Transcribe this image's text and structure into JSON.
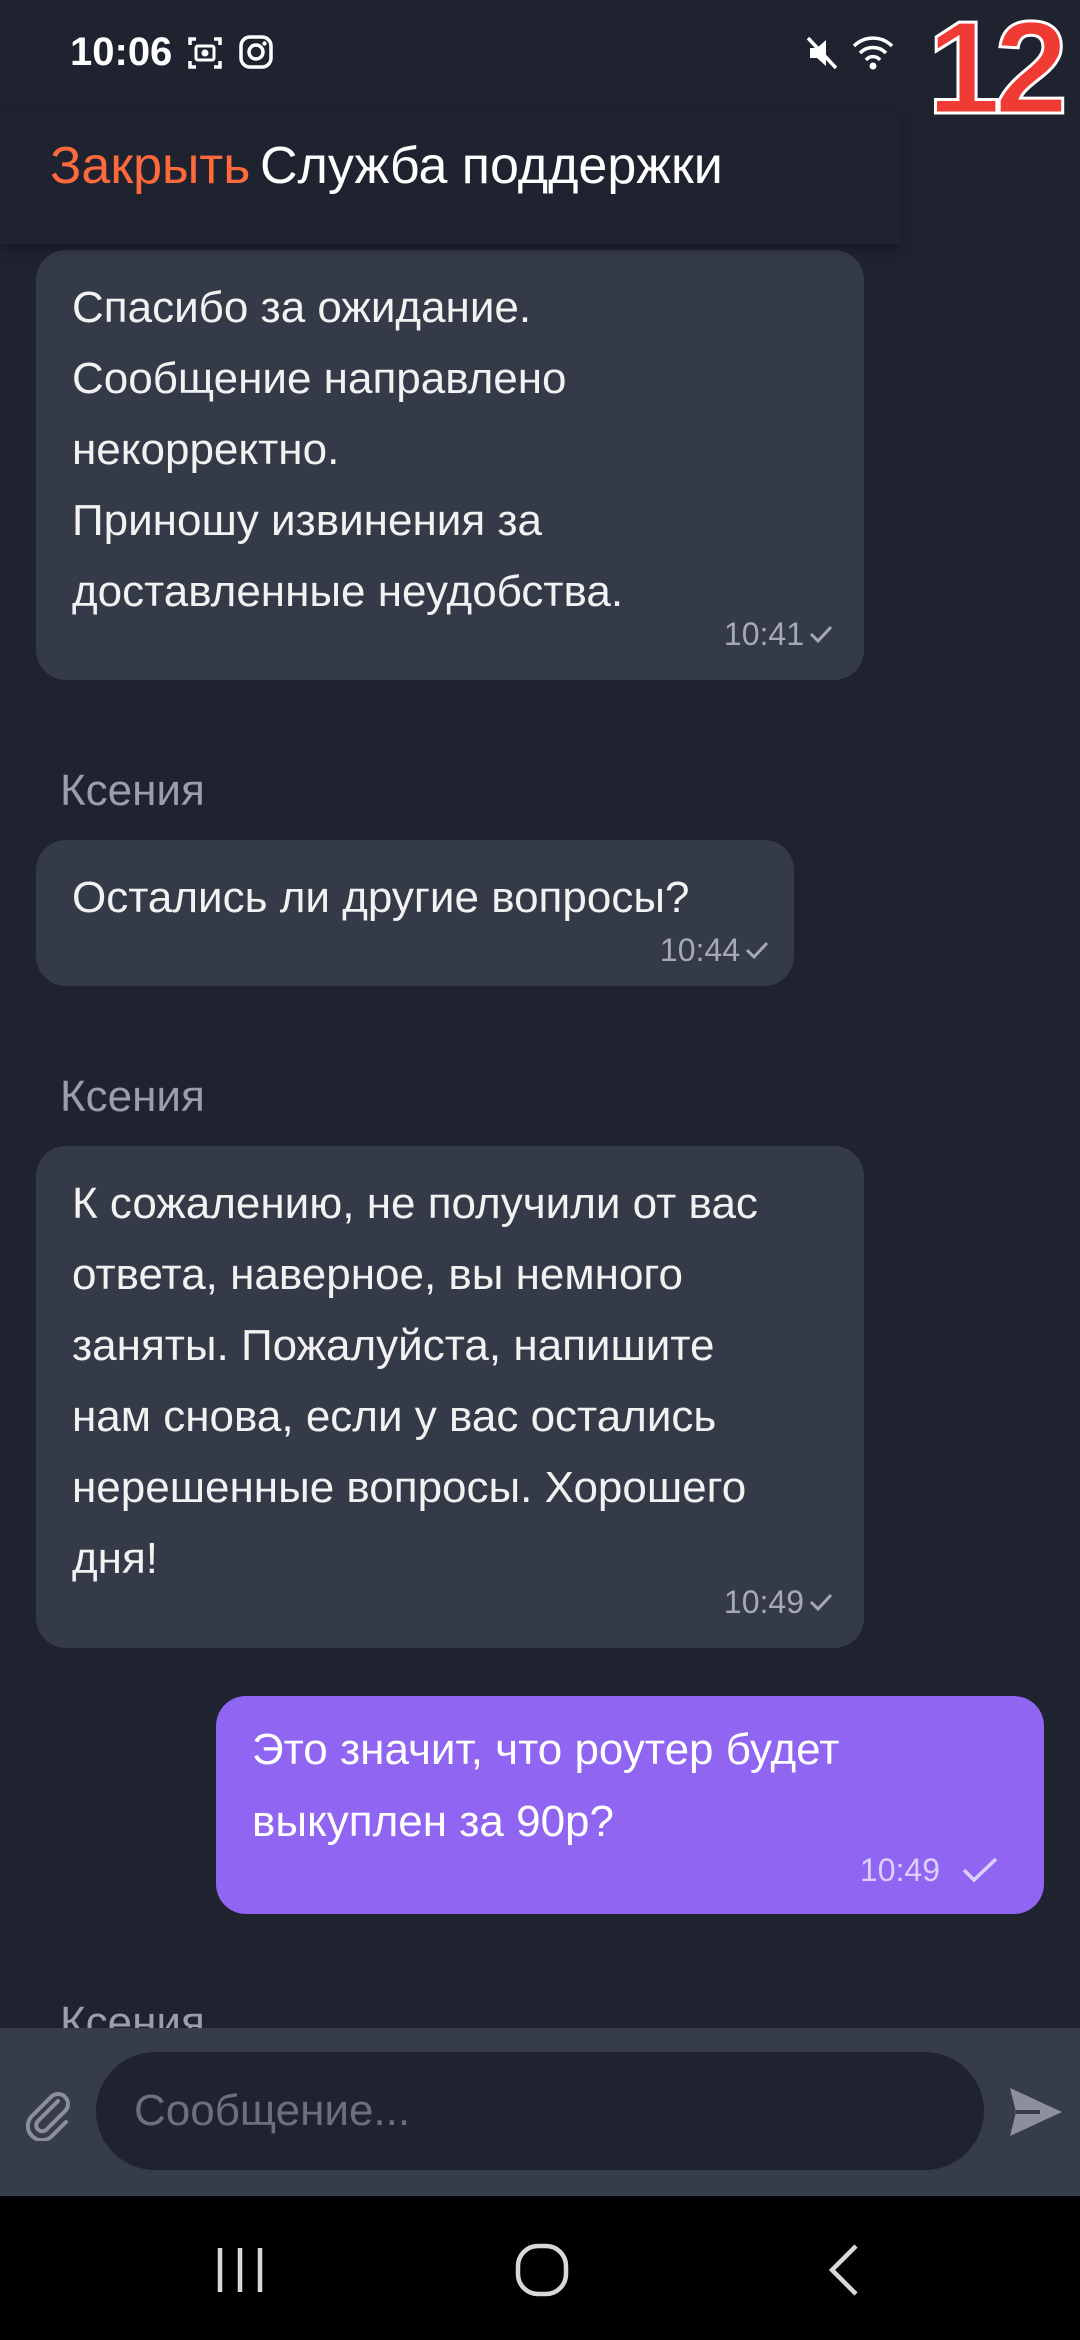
{
  "status_bar": {
    "time": "10:06",
    "overlay_number": "12",
    "icons": [
      "screenshot-icon",
      "instagram-icon",
      "mute-icon",
      "wifi-icon"
    ]
  },
  "header": {
    "close_label": "Закрыть",
    "title": "Служба поддержки"
  },
  "messages": [
    {
      "direction": "incoming",
      "lines": [
        "Спасибо за ожидание.",
        "Сообщение направлено",
        "некорректно.",
        "Приношу извинения за",
        "доставленные неудобства."
      ],
      "time": "10:41",
      "status_icon": "check-icon"
    },
    {
      "sender": "Ксения",
      "direction": "incoming",
      "lines": [
        "Остались ли другие вопросы?"
      ],
      "time": "10:44",
      "status_icon": "check-icon"
    },
    {
      "sender": "Ксения",
      "direction": "incoming",
      "lines": [
        "К сожалению, не получили от вас",
        "ответа, наверное, вы немного",
        "заняты. Пожалуйста, напишите",
        "нам снова, если у вас остались",
        "нерешенные вопросы. Хорошего",
        "дня!"
      ],
      "time": "10:49",
      "status_icon": "check-icon"
    },
    {
      "direction": "outgoing",
      "lines": [
        "Это значит, что роутер будет",
        "выкуплен за 90р?"
      ],
      "time": "10:49",
      "status_icon": "check-icon"
    },
    {
      "sender": "Ксения",
      "direction": "incoming",
      "partially_visible": true
    }
  ],
  "composer": {
    "placeholder": "Сообщение..."
  },
  "colors": {
    "background": "#1f2330",
    "incoming_bubble": "#353a48",
    "outgoing_bubble": "#8f65f2",
    "accent": "#ff6a3d"
  }
}
